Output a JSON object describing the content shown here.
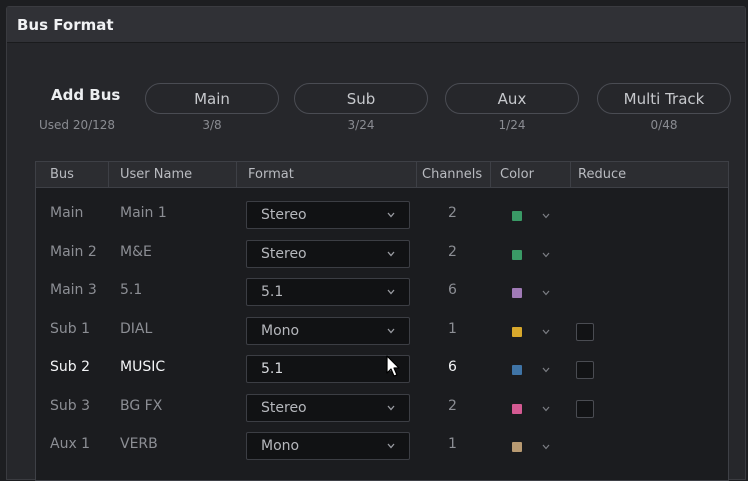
{
  "window": {
    "title": "Bus Format"
  },
  "add_bus": {
    "label": "Add Bus",
    "used": "Used 20/128",
    "buttons": [
      {
        "label": "Main",
        "count": "3/8"
      },
      {
        "label": "Sub",
        "count": "3/24"
      },
      {
        "label": "Aux",
        "count": "1/24"
      },
      {
        "label": "Multi Track",
        "count": "0/48"
      }
    ]
  },
  "table": {
    "headers": {
      "bus": "Bus",
      "user_name": "User Name",
      "format": "Format",
      "channels": "Channels",
      "color": "Color",
      "reduce": "Reduce"
    },
    "rows": [
      {
        "bus": "Main",
        "user_name": "Main 1",
        "format": "Stereo",
        "channels": "2",
        "color": "#3a9a66",
        "reduce": null
      },
      {
        "bus": "Main 2",
        "user_name": "M&E",
        "format": "Stereo",
        "channels": "2",
        "color": "#3a9a66",
        "reduce": null
      },
      {
        "bus": "Main 3",
        "user_name": "5.1",
        "format": "5.1",
        "channels": "6",
        "color": "#a07ab6",
        "reduce": null
      },
      {
        "bus": "Sub 1",
        "user_name": "DIAL",
        "format": "Mono",
        "channels": "1",
        "color": "#d8a82c",
        "reduce": false
      },
      {
        "bus": "Sub 2",
        "user_name": "MUSIC",
        "format": "5.1",
        "channels": "6",
        "color": "#3f74a6",
        "reduce": false,
        "active": true
      },
      {
        "bus": "Sub 3",
        "user_name": "BG FX",
        "format": "Stereo",
        "channels": "2",
        "color": "#d45a92",
        "reduce": false
      },
      {
        "bus": "Aux 1",
        "user_name": "VERB",
        "format": "Mono",
        "channels": "1",
        "color": "#b89a72",
        "reduce": null
      }
    ]
  }
}
